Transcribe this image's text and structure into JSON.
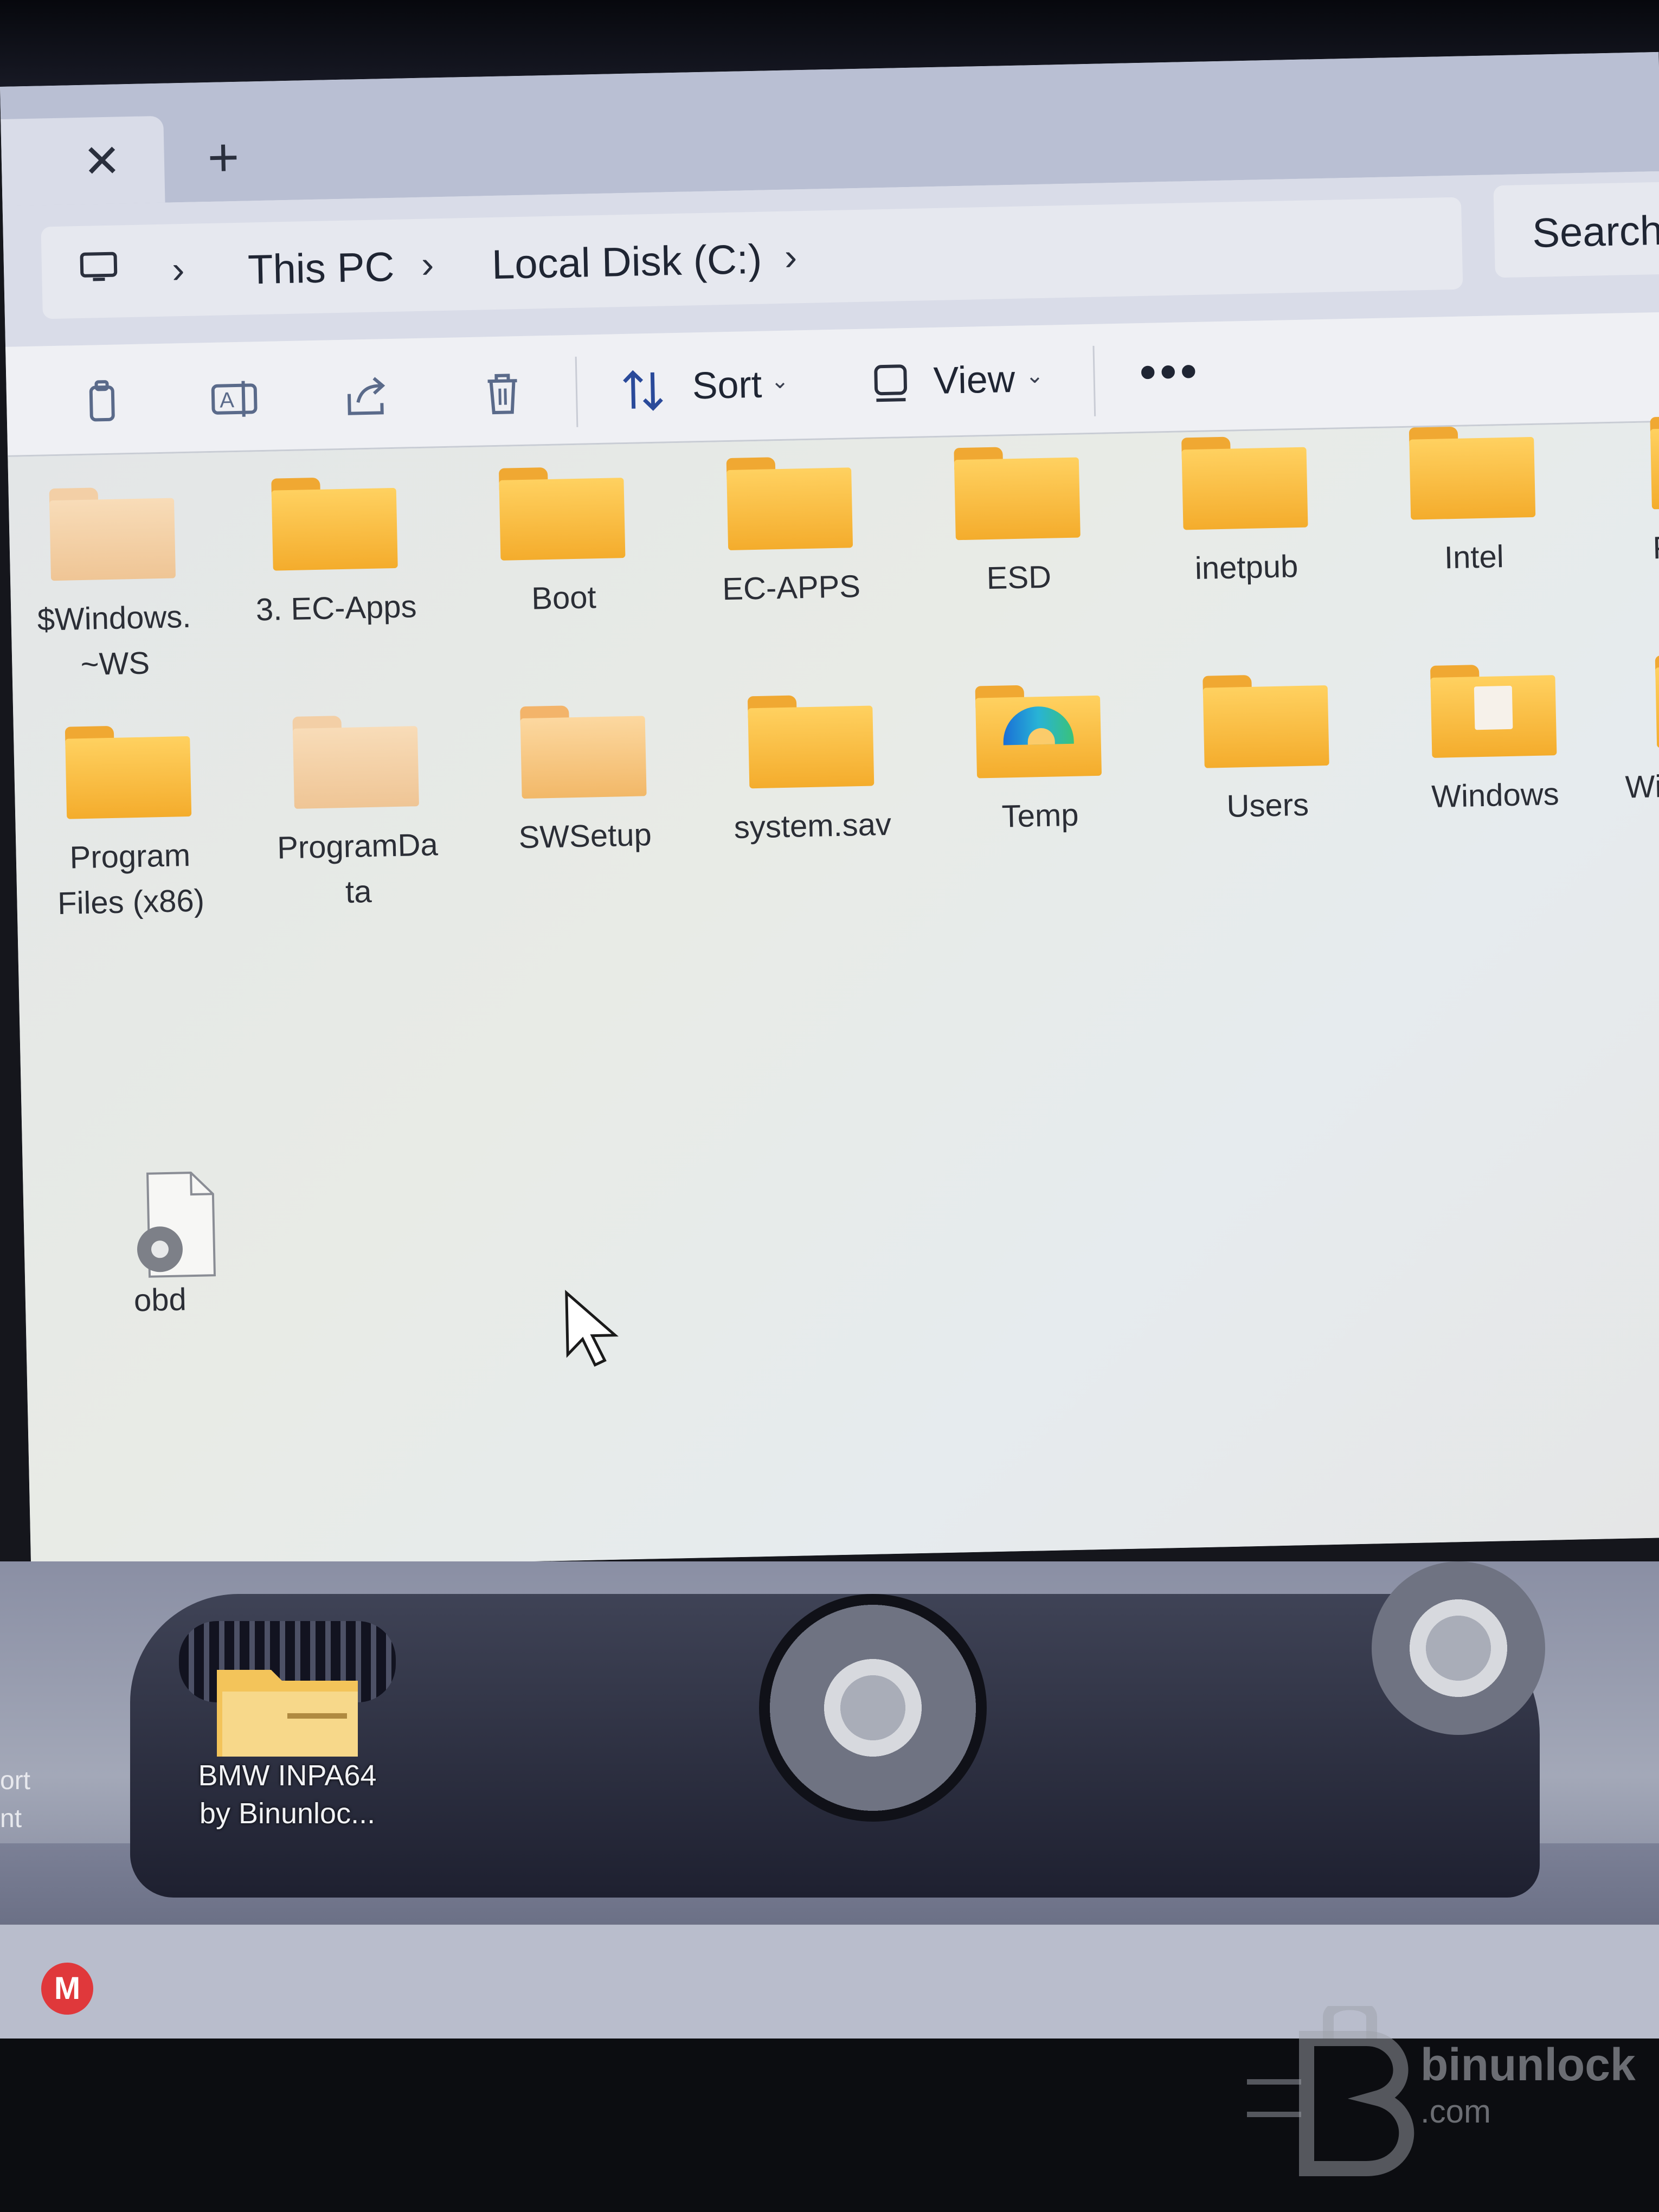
{
  "window": {
    "tab_close": "✕",
    "new_tab": "+"
  },
  "address": {
    "crumbs": [
      "This PC",
      "Local Disk (C:)"
    ],
    "search_placeholder": "Search"
  },
  "toolbar": {
    "sort_label": "Sort",
    "view_label": "View",
    "more_label": "•••"
  },
  "items": [
    {
      "label": "$Windows.\n~WS",
      "line1": "$Windows.",
      "line2": "~WS",
      "kind": "folder-faded"
    },
    {
      "label": "3. EC-Apps",
      "line1": "3. EC-Apps",
      "line2": "",
      "kind": "folder"
    },
    {
      "label": "Boot",
      "line1": "Boot",
      "line2": "",
      "kind": "folder"
    },
    {
      "label": "EC-APPS",
      "line1": "EC-APPS",
      "line2": "",
      "kind": "folder"
    },
    {
      "label": "ESD",
      "line1": "ESD",
      "line2": "",
      "kind": "folder"
    },
    {
      "label": "inetpub",
      "line1": "inetpub",
      "line2": "",
      "kind": "folder"
    },
    {
      "label": "Intel",
      "line1": "Intel",
      "line2": "",
      "kind": "folder"
    },
    {
      "label": "P",
      "line1": "P",
      "line2": "",
      "kind": "folder-partial"
    },
    {
      "label": "Program Files (x86)",
      "line1": "Program",
      "line2": "Files (x86)",
      "kind": "folder"
    },
    {
      "label": "ProgramData",
      "line1": "ProgramDa",
      "line2": "ta",
      "kind": "folder-faded"
    },
    {
      "label": "SWSetup",
      "line1": "SWSetup",
      "line2": "",
      "kind": "folder-light"
    },
    {
      "label": "system.sav",
      "line1": "system.sav",
      "line2": "",
      "kind": "folder"
    },
    {
      "label": "Temp",
      "line1": "Temp",
      "line2": "",
      "kind": "folder-temp"
    },
    {
      "label": "Users",
      "line1": "Users",
      "line2": "",
      "kind": "folder"
    },
    {
      "label": "Windows",
      "line1": "Windows",
      "line2": "",
      "kind": "folder-doc"
    },
    {
      "label": "Wir",
      "line1": "Wir",
      "line2": "",
      "kind": "folder-partial"
    }
  ],
  "file": {
    "label": "obd",
    "icon": "settings-file-icon"
  },
  "desktop": {
    "folder_line1": "BMW INPA64",
    "folder_line2": "by Binunloc...",
    "left_line1": "ort",
    "left_line2": "nt"
  },
  "taskbar": {
    "app_letter": "M"
  },
  "watermark": {
    "text": "binunlock",
    "sub": ".com"
  },
  "colors": {
    "folder": "#f4ac2c",
    "accent": "#1a6fd6",
    "mega": "#e0383b"
  }
}
